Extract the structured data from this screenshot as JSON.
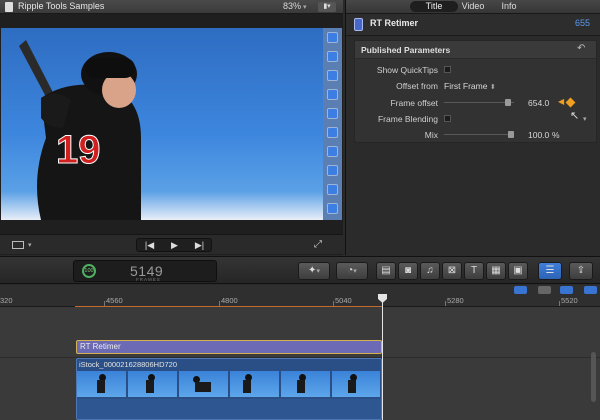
{
  "viewer": {
    "title": "Ripple Tools Samples",
    "zoom": "83%",
    "jersey_number": "19"
  },
  "inspector": {
    "tabs": [
      "Title",
      "Video",
      "Info"
    ],
    "plugin_name": "RT Retimer",
    "frame_count": "655",
    "section_title": "Published Parameters",
    "params": {
      "show_quicktips": "Show QuickTips",
      "offset_from_label": "Offset from",
      "offset_from_value": "First Frame",
      "frame_offset_label": "Frame offset",
      "frame_offset_value": "654.0",
      "frame_offset_fraction": 0.95,
      "frame_blending": "Frame Blending",
      "mix_label": "Mix",
      "mix_value": "100.0",
      "mix_unit": "%",
      "mix_fraction": 1.0
    }
  },
  "timecode": {
    "percent": "100",
    "value": "5149",
    "unit": "FRAMES"
  },
  "ruler": {
    "labels": [
      "320",
      "4560",
      "4800",
      "5040",
      "5280",
      "5520"
    ]
  },
  "timeline": {
    "effect_clip": "RT Retimer",
    "video_clip": "iStock_000021628806HD720"
  },
  "colors": {
    "accent_blue": "#5a9af0",
    "keyframe_orange": "#f0a020",
    "effect_clip": "#6c6ab4",
    "video_clip": "#2a4f86"
  }
}
